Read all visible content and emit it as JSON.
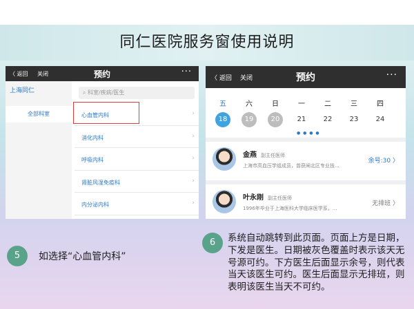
{
  "slide": {
    "title": "同仁医院服务窗使用说明"
  },
  "left_phone": {
    "nav": {
      "back_label": "〈 返回",
      "close_label": "关闭",
      "title": "预约",
      "more": "···"
    },
    "sidebar": {
      "city": "上海同仁",
      "all_depts": "全部科室"
    },
    "search": {
      "placeholder": "科室/疾病/医生"
    },
    "departments": [
      {
        "label": "心血管内科"
      },
      {
        "label": "消化内科"
      },
      {
        "label": "呼吸内科"
      },
      {
        "label": "肾脏风湿免疫科"
      },
      {
        "label": "内分泌内科"
      }
    ]
  },
  "right_phone": {
    "nav": {
      "back_label": "〈 返回",
      "close_label": "关闭",
      "title": "预约",
      "more": "···"
    },
    "weekdays": [
      "五",
      "六",
      "日",
      "一",
      "二",
      "三",
      "四"
    ],
    "dates": [
      "18",
      "19",
      "20",
      "21",
      "22",
      "23",
      "24"
    ],
    "page_dots": "● ● ● ●",
    "doctors": [
      {
        "name": "金燕",
        "rank": "副主任医师",
        "desc": "上海市高血压学组成员，曾获闸北区专业技...",
        "status": "余号:30 〉"
      },
      {
        "name": "叶永刚",
        "rank": "副主任医师",
        "desc": "1996年毕业于上海医科大学临床医学系，...",
        "status": "无排班 〉"
      }
    ]
  },
  "steps": {
    "step5": {
      "num": "5",
      "text": "如选择“心血管内科”"
    },
    "step6": {
      "num": "6",
      "text": "系统自动跳转到此页面。页面上方是日期，下发是医生。日期被灰色覆盖时表示该天无号源可约。下方医生后面显示余号，则代表当天该医生可约。医生后面显示无排班，则表明该医生当天不可约。"
    }
  },
  "colors": {
    "accent_blue": "#2c78c8",
    "today_blue": "#3ea3e0",
    "badge_green": "#5aa38b",
    "highlight_red": "#e23b3b"
  }
}
